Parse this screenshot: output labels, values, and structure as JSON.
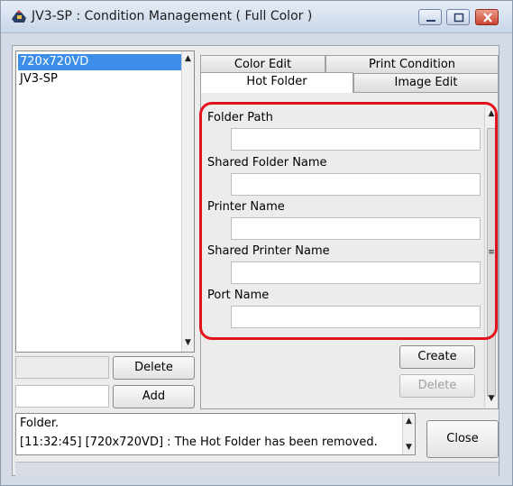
{
  "window": {
    "title": "JV3-SP : Condition Management ( Full Color )",
    "controls": [
      "minimize-icon",
      "maximize-icon",
      "close-icon"
    ]
  },
  "conditions_list": {
    "items": [
      {
        "label": "720x720VD",
        "selected": true
      },
      {
        "label": "JV3-SP",
        "selected": false
      }
    ],
    "delete_label": "Delete",
    "add_label": "Add"
  },
  "tabs": {
    "row_back": [
      {
        "label": "Color Edit"
      },
      {
        "label": "Print Condition"
      }
    ],
    "row_front": [
      {
        "label": "Hot Folder",
        "active": true
      },
      {
        "label": "Image Edit"
      }
    ]
  },
  "hot_folder": {
    "fields": [
      {
        "label": "Folder Path",
        "value": ""
      },
      {
        "label": "Shared Folder Name",
        "value": ""
      },
      {
        "label": "Printer Name",
        "value": ""
      },
      {
        "label": "Shared Printer Name",
        "value": ""
      },
      {
        "label": "Port Name",
        "value": ""
      }
    ],
    "create_label": "Create",
    "delete_label": "Delete"
  },
  "log": {
    "lines": [
      "Folder.",
      "[11:32:45] [720x720VD] : The Hot Folder has been removed."
    ],
    "close_label": "Close"
  },
  "colors": {
    "selection": "#3d8ee8",
    "highlight": "#e2141b",
    "close_button": "#c94430"
  }
}
